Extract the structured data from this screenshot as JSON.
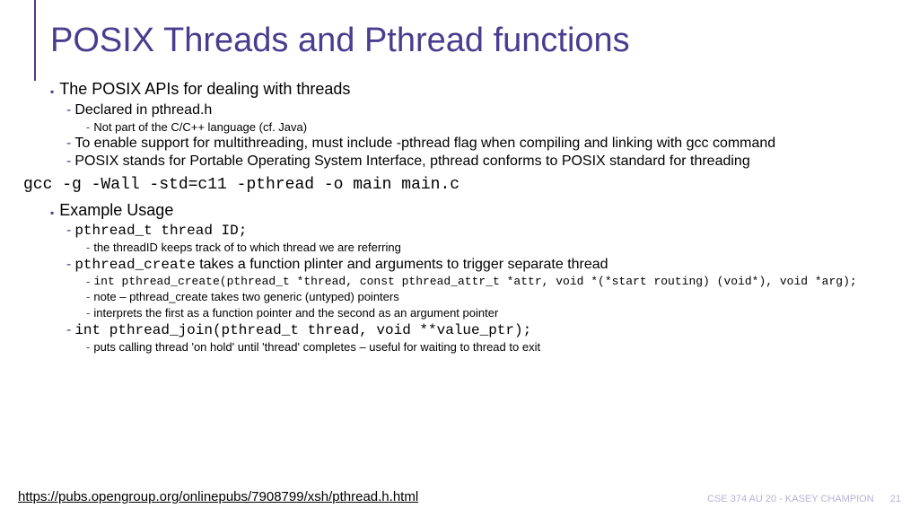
{
  "title": "POSIX Threads and Pthread functions",
  "b1": {
    "text": "The POSIX APIs for dealing with threads",
    "s1": "Declared in pthread.h",
    "s1a": "Not part of the C/C++ language (cf. Java)",
    "s2": "To enable support for multithreading, must include -pthread flag when compiling and linking with gcc command",
    "s3": "POSIX stands for Portable Operating System Interface, pthread conforms to POSIX standard for threading"
  },
  "gcc": "gcc -g -Wall -std=c11 -pthread -o main main.c",
  "b2": {
    "text": "Example Usage",
    "s1": "pthread_t thread ID;",
    "s1a": "the threadID keeps track of to which thread we are referring",
    "s2_code": "pthread_create",
    "s2_text": "  takes a function plinter and arguments to trigger separate thread",
    "s2a": "int pthread_create(pthread_t *thread, const pthread_attr_t *attr, void *(*start routing) (void*), void *arg);",
    "s2b": "note – pthread_create takes two generic (untyped) pointers",
    "s2c": "interprets the first as a function pointer and the second as an argument pointer",
    "s3": "int pthread_join(pthread_t thread, void **value_ptr);",
    "s3a": "puts calling thread 'on hold' until 'thread' completes – useful for waiting to thread to exit"
  },
  "footer": {
    "link": "https://pubs.opengroup.org/onlinepubs/7908799/xsh/pthread.h.html",
    "course": "CSE 374 AU 20 - KASEY CHAMPION",
    "page": "21"
  }
}
